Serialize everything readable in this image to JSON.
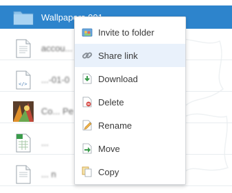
{
  "files": [
    {
      "name": "Wallpapers 001",
      "kind": "folder",
      "selected": true
    },
    {
      "name": "accou...",
      "kind": "document",
      "selected": false
    },
    {
      "name": "...-01-0",
      "kind": "code",
      "selected": false
    },
    {
      "name": "Co... Pe",
      "kind": "image",
      "selected": false
    },
    {
      "name": "...",
      "kind": "spreadsheet",
      "selected": false
    },
    {
      "name": "... n",
      "kind": "document",
      "selected": false
    }
  ],
  "context_menu": {
    "items": [
      {
        "label": "Invite to folder",
        "icon": "invite-folder-icon"
      },
      {
        "label": "Share link",
        "icon": "share-link-icon",
        "highlighted": true
      },
      {
        "label": "Download",
        "icon": "download-icon"
      },
      {
        "label": "Delete",
        "icon": "delete-icon"
      },
      {
        "label": "Rename",
        "icon": "rename-icon"
      },
      {
        "label": "Move",
        "icon": "move-icon"
      },
      {
        "label": "Copy",
        "icon": "copy-icon"
      }
    ]
  },
  "colors": {
    "selected_row": "#2d84cc",
    "menu_hover": "#e9f1fb"
  }
}
